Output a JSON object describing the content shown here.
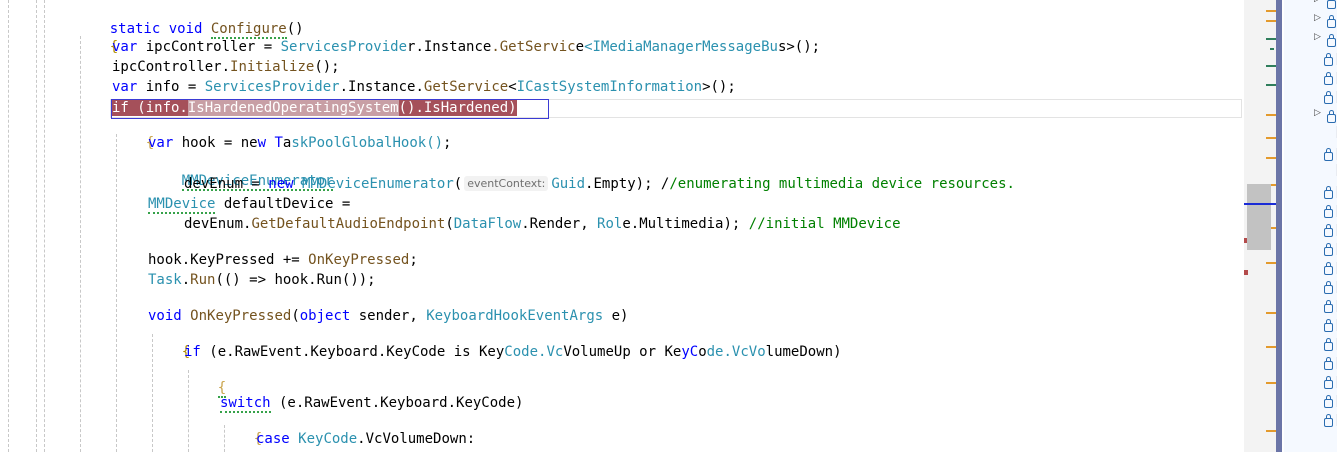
{
  "editor": {
    "lines": [
      "static void Configure()",
      "{",
      "var ipcController = ServicesProvider.Instance.GetService<IMediaManagerMessageBus>();",
      "ipcController.Initialize();",
      "var info = ServicesProvider.Instance.GetService<ICastSystemInformation>();",
      "if (info.IsHardenedOperatingSystem().IsHardened)",
      "{",
      "var hook = new TaskPoolGlobalHook();",
      "MMDeviceEnumerator",
      "devEnum = new MMDeviceEnumerator(",
      "Guid.Empty); //enumerating multimedia device resources.",
      "MMDevice defaultDevice =",
      "devEnum.GetDefaultAudioEndpoint(DataFlow.Render, Role.Multimedia); //initial MMDevice",
      "hook.KeyPressed += OnKeyPressed;",
      "Task.Run(() => hook.Run());",
      "void OnKeyPressed(object sender, KeyboardHookEventArgs e)",
      "{",
      "if (e.RawEvent.Keyboard.KeyCode is KeyCode.VcVolumeUp or KeyCode.VcVolumeDown)",
      "{",
      "switch (e.RawEvent.Keyboard.KeyCode)",
      "{",
      "case KeyCode.VcVolumeDown:"
    ],
    "inlay_hint": "eventContext:"
  },
  "colors": {
    "keyword": "#0000ff",
    "type": "#2b91af",
    "method": "#74531f",
    "comment": "#008000",
    "breakpoint_selection": "#a5505a",
    "scrollbar_accent": "#6b75a7"
  },
  "solution_explorer": {
    "row_icons": [
      "expander",
      "expander",
      "expander",
      "lock",
      "lock",
      "lock",
      "expander",
      "brace",
      "lock",
      "brace",
      "lock",
      "lock",
      "lock",
      "lock",
      "lock",
      "lock",
      "lock",
      "lock",
      "lock",
      "lock",
      "lock",
      "lock",
      "lock"
    ]
  }
}
